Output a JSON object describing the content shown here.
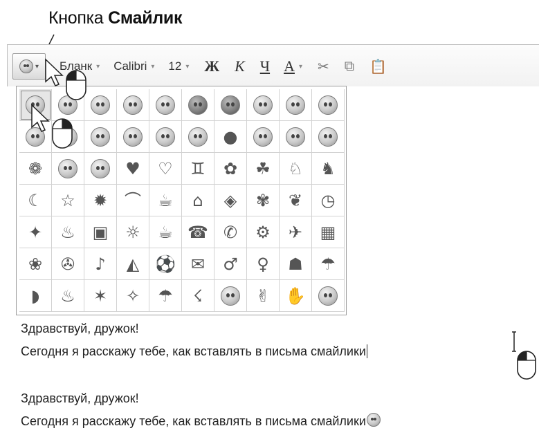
{
  "caption": {
    "prefix": "Кнопка",
    "bold": "Смайлик"
  },
  "toolbar": {
    "smiley_button": "smiley-icon",
    "style_label": "Бланк",
    "font_label": "Calibri",
    "size_label": "12",
    "bold_label": "Ж",
    "italic_label": "К",
    "underline_label": "Ч",
    "font_color_label": "А",
    "drop_glyph": "▾"
  },
  "emoticons": {
    "rows": [
      [
        "smile",
        "wink",
        "happy",
        "surprised",
        "tongue",
        "cool",
        "angry",
        "embarrassed",
        "sad",
        "crying"
      ],
      [
        "kiss",
        "confused",
        "grin",
        "shocked",
        "nerd",
        "thinking",
        "party",
        "huh",
        "sarcastic",
        "sealed-lips"
      ],
      [
        "baby",
        "devil",
        "angel",
        "heart",
        "broken-heart",
        "people",
        "cat",
        "dog",
        "snail",
        "sheep"
      ],
      [
        "moon",
        "star",
        "sun",
        "rainbow",
        "coffee-couple",
        "gift-box",
        "lips",
        "rose",
        "wilted-rose",
        "clock"
      ],
      [
        "presents",
        "cake",
        "camera",
        "bulb",
        "coffee",
        "phone",
        "mobile",
        "car",
        "plane",
        "computer"
      ],
      [
        "rabbit",
        "film",
        "music-note",
        "pizza",
        "soccer-ball",
        "mail",
        "boy",
        "girl",
        "island",
        "umbrella"
      ],
      [
        "foot",
        "bird",
        "bat",
        "top",
        "rain",
        "lightning",
        "sick",
        "fingers-crossed",
        "hands",
        "sleepy"
      ]
    ],
    "glyphs": [
      [
        "●",
        "●",
        "●",
        "●",
        "●",
        "●",
        "●",
        "●",
        "●",
        "●"
      ],
      [
        "●",
        "●",
        "●",
        "●",
        "●",
        "●",
        "●",
        "●",
        "●",
        "●"
      ],
      [
        "❁",
        "●",
        "●",
        "♥",
        "♡",
        "♊",
        "✿",
        "☘",
        "♘",
        "♞"
      ],
      [
        "☾",
        "☆",
        "✹",
        "⌒",
        "☕",
        "⌂",
        "◈",
        "✾",
        "❦",
        "◷"
      ],
      [
        "✦",
        "♨",
        "▣",
        "☼",
        "☕",
        "☎",
        "✆",
        "⚙",
        "✈",
        "▦"
      ],
      [
        "❀",
        "✇",
        "♪",
        "◭",
        "⚽",
        "✉",
        "♂",
        "♀",
        "☗",
        "☂"
      ],
      [
        "◗",
        "♨",
        "✶",
        "✧",
        "☂",
        "☇",
        "●",
        "✌",
        "✋",
        "●"
      ]
    ],
    "faces": [
      [
        1,
        1,
        1,
        1,
        1,
        2,
        2,
        1,
        1,
        1
      ],
      [
        1,
        1,
        1,
        1,
        1,
        1,
        0,
        1,
        1,
        1
      ],
      [
        0,
        1,
        1,
        0,
        0,
        0,
        0,
        0,
        0,
        0
      ],
      [
        0,
        0,
        0,
        0,
        0,
        0,
        0,
        0,
        0,
        0
      ],
      [
        0,
        0,
        0,
        0,
        0,
        0,
        0,
        0,
        0,
        0
      ],
      [
        0,
        0,
        0,
        0,
        0,
        0,
        0,
        0,
        0,
        0
      ],
      [
        0,
        0,
        0,
        0,
        0,
        0,
        1,
        0,
        0,
        1
      ]
    ],
    "highlighted": "smile"
  },
  "editor_before": {
    "line1": "Здравствуй, дружок!",
    "line2": "Сегодня я расскажу тебе, как вставлять в письма смайлики"
  },
  "editor_after": {
    "line1": "Здравствуй, дружок!",
    "line2": "Сегодня я расскажу тебе, как вставлять в письма смайлики",
    "inserted_emoticon": "smile"
  }
}
